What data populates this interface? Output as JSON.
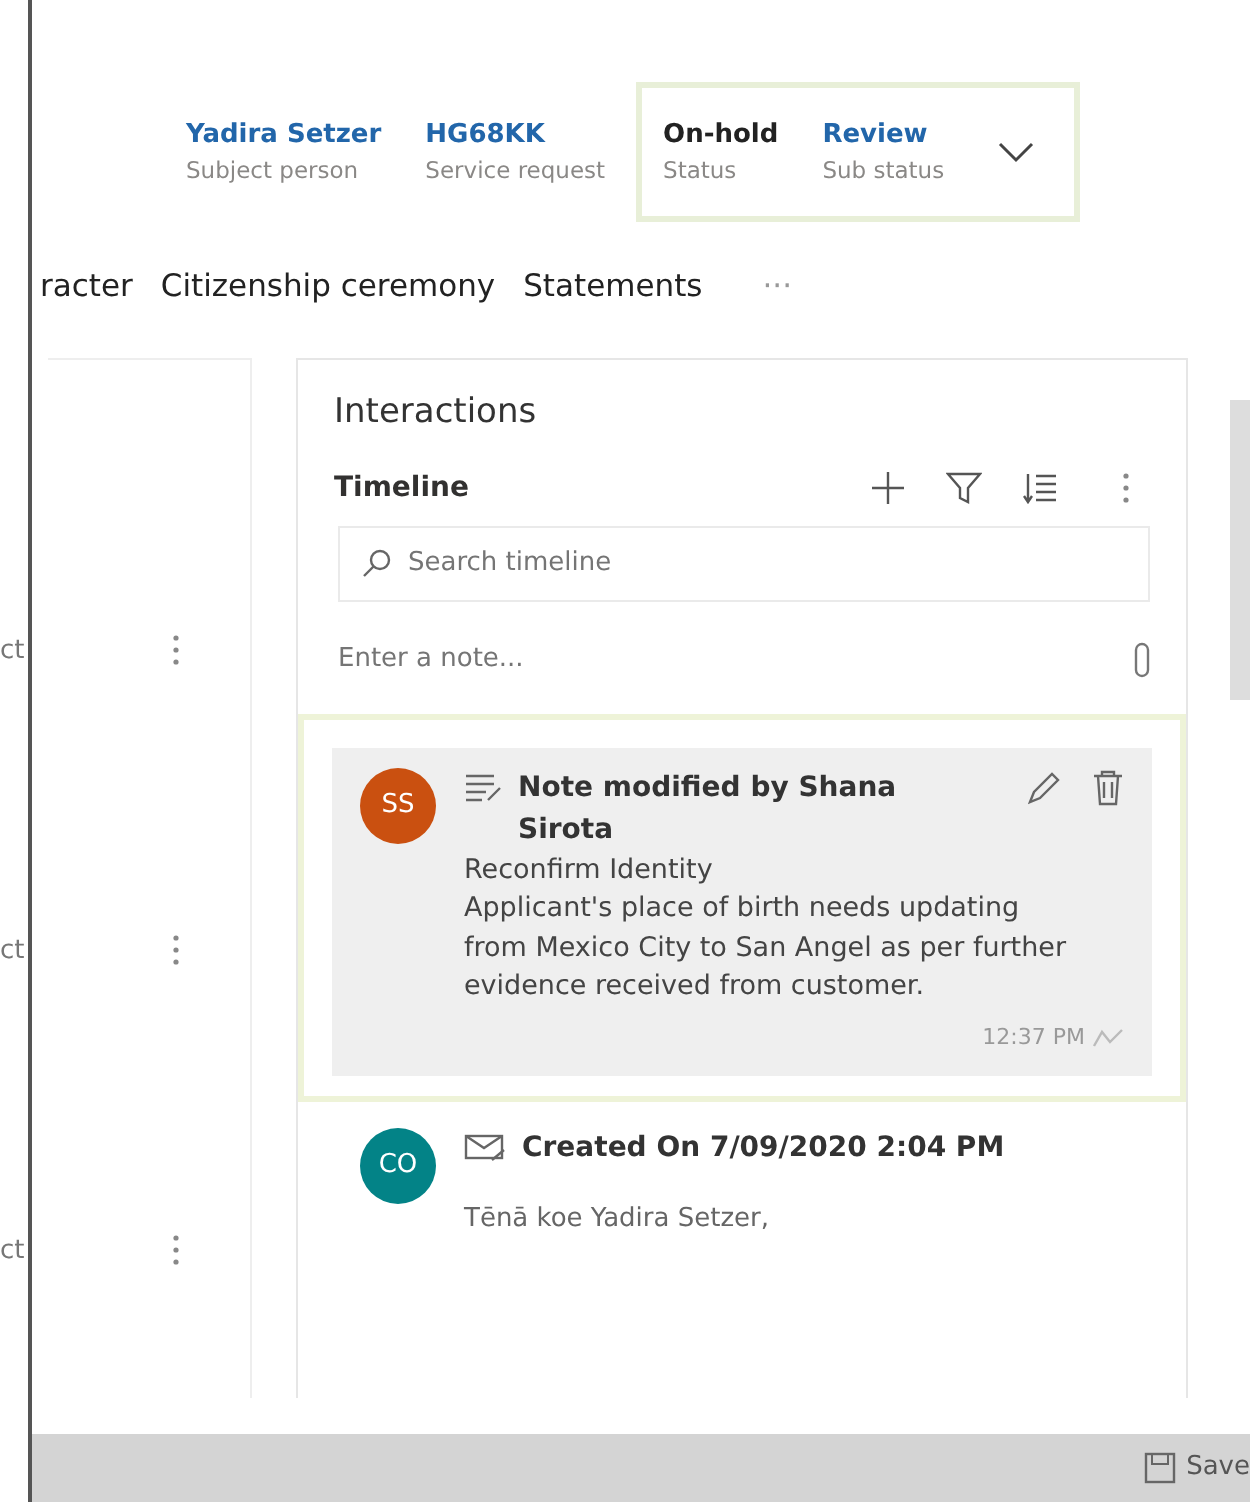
{
  "header": {
    "fields": [
      {
        "value": "Yadira Setzer",
        "label": "Subject person",
        "kind": "link"
      },
      {
        "value": "HG68KK",
        "label": "Service request",
        "kind": "link"
      },
      {
        "value": "On-hold",
        "label": "Status",
        "kind": "plain"
      },
      {
        "value": "Review",
        "label": "Sub status",
        "kind": "link"
      }
    ]
  },
  "tabs": [
    {
      "label": "racter",
      "selected": false
    },
    {
      "label": "Citizenship ceremony",
      "selected": false
    },
    {
      "label": "Statements",
      "selected": false
    },
    {
      "label": "···",
      "selected": false
    }
  ],
  "side_list": {
    "rows": [
      {
        "label": "ct"
      },
      {
        "label": "ct"
      },
      {
        "label": "ct"
      }
    ]
  },
  "interactions": {
    "title": "Interactions",
    "timeline": {
      "title": "Timeline",
      "search": {
        "placeholder": "Search timeline"
      },
      "note": {
        "placeholder": "Enter a note..."
      },
      "entries": [
        {
          "kind": "note",
          "initials": "SS",
          "color": "#ca5010",
          "selected": true,
          "title": "Note modified by Shana Sirota",
          "subject": "Reconfirm Identity",
          "body": "Applicant's place of birth needs updating from Mexico City to San Angel as per further evidence received from customer.",
          "time": "12:37 PM"
        },
        {
          "kind": "email",
          "initials": "CO",
          "color": "#038387",
          "selected": false,
          "title": "Created On 7/09/2020 2:04 PM",
          "subject": "Tēnā koe Yadira Setzer,"
        }
      ]
    }
  },
  "footer": {
    "save": "Save"
  }
}
